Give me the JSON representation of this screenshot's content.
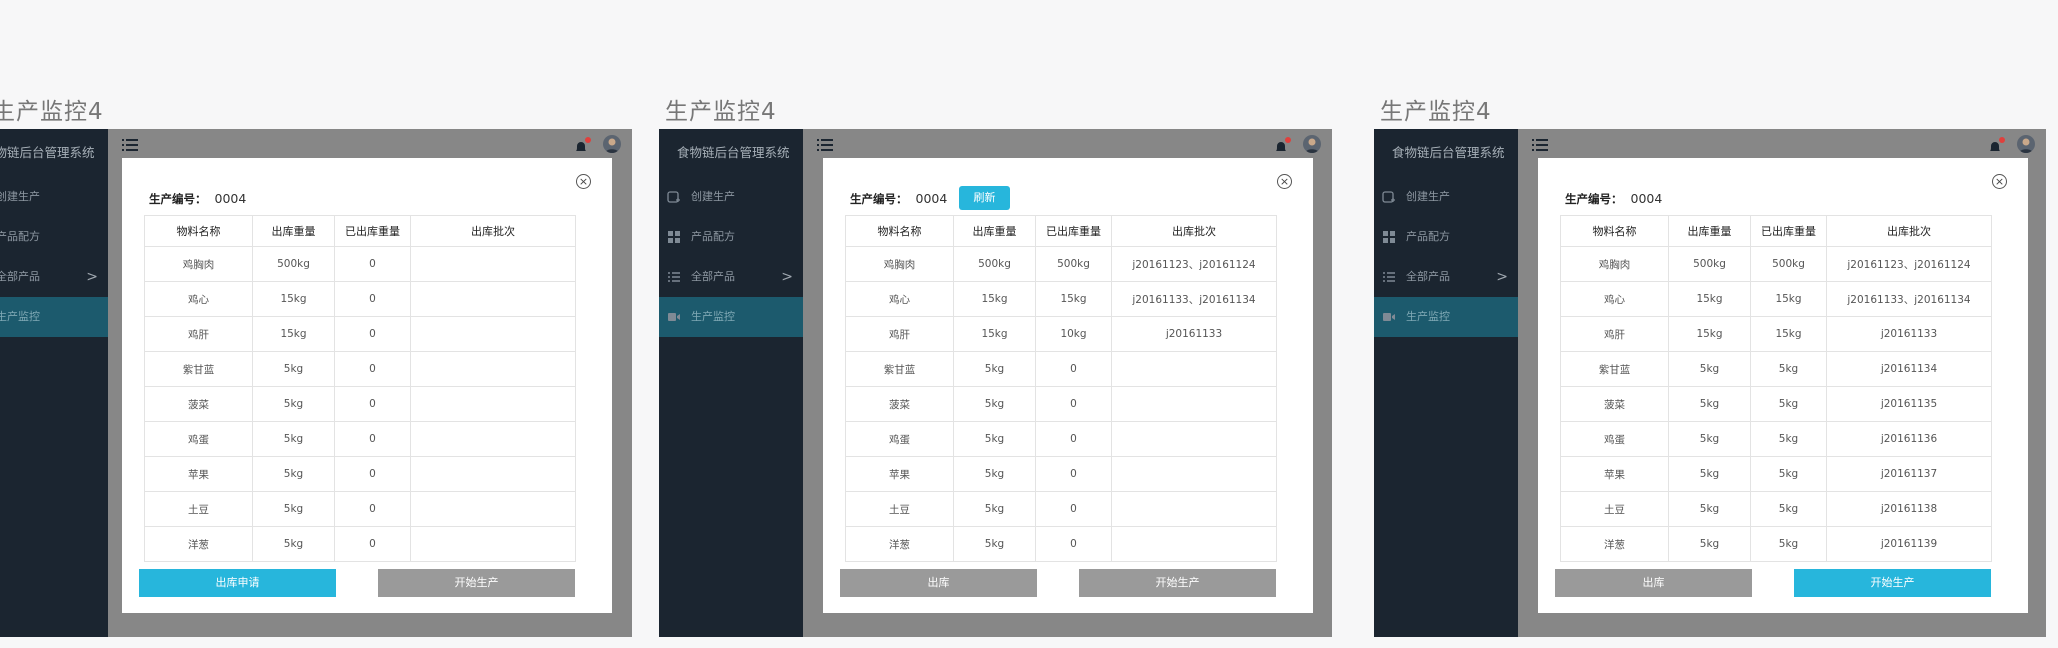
{
  "artboards": [
    {
      "title": "生产监控4",
      "brand": "食物链后台管理系统",
      "nav": [
        {
          "label": "创建生产",
          "icon": "create-production-icon"
        },
        {
          "label": "产品配方",
          "icon": "grid-icon"
        },
        {
          "label": "全部产品",
          "icon": "list-icon",
          "arrow": ">"
        },
        {
          "label": "生产监控",
          "icon": "video-icon",
          "active": true
        }
      ],
      "modal": {
        "code_label": "生产编号：",
        "code_value": "0004",
        "refresh_label": "",
        "columns": [
          "物料名称",
          "出库重量",
          "已出库重量",
          "出库批次"
        ],
        "rows": [
          [
            "鸡胸肉",
            "500kg",
            "0",
            ""
          ],
          [
            "鸡心",
            "15kg",
            "0",
            ""
          ],
          [
            "鸡肝",
            "15kg",
            "0",
            ""
          ],
          [
            "紫甘蓝",
            "5kg",
            "0",
            ""
          ],
          [
            "菠菜",
            "5kg",
            "0",
            ""
          ],
          [
            "鸡蛋",
            "5kg",
            "0",
            ""
          ],
          [
            "苹果",
            "5kg",
            "0",
            ""
          ],
          [
            "土豆",
            "5kg",
            "0",
            ""
          ],
          [
            "洋葱",
            "5kg",
            "0",
            ""
          ]
        ],
        "left_button": "出库申请",
        "right_button": "开始生产",
        "left_button_style": "blue",
        "right_button_style": "gray"
      }
    },
    {
      "title": "生产监控4",
      "brand": "食物链后台管理系统",
      "nav": [
        {
          "label": "创建生产",
          "icon": "create-production-icon"
        },
        {
          "label": "产品配方",
          "icon": "grid-icon"
        },
        {
          "label": "全部产品",
          "icon": "list-icon",
          "arrow": ">"
        },
        {
          "label": "生产监控",
          "icon": "video-icon",
          "active": true
        }
      ],
      "modal": {
        "code_label": "生产编号：",
        "code_value": "0004",
        "refresh_label": "刷新",
        "columns": [
          "物料名称",
          "出库重量",
          "已出库重量",
          "出库批次"
        ],
        "rows": [
          [
            "鸡胸肉",
            "500kg",
            "500kg",
            "j20161123、j20161124"
          ],
          [
            "鸡心",
            "15kg",
            "15kg",
            "j20161133、j20161134"
          ],
          [
            "鸡肝",
            "15kg",
            "10kg",
            "j20161133"
          ],
          [
            "紫甘蓝",
            "5kg",
            "0",
            ""
          ],
          [
            "菠菜",
            "5kg",
            "0",
            ""
          ],
          [
            "鸡蛋",
            "5kg",
            "0",
            ""
          ],
          [
            "苹果",
            "5kg",
            "0",
            ""
          ],
          [
            "土豆",
            "5kg",
            "0",
            ""
          ],
          [
            "洋葱",
            "5kg",
            "0",
            ""
          ]
        ],
        "left_button": "出库",
        "right_button": "开始生产",
        "left_button_style": "gray",
        "right_button_style": "gray"
      }
    },
    {
      "title": "生产监控4",
      "brand": "食物链后台管理系统",
      "nav": [
        {
          "label": "创建生产",
          "icon": "create-production-icon"
        },
        {
          "label": "产品配方",
          "icon": "grid-icon"
        },
        {
          "label": "全部产品",
          "icon": "list-icon",
          "arrow": ">"
        },
        {
          "label": "生产监控",
          "icon": "video-icon",
          "active": true
        }
      ],
      "modal": {
        "code_label": "生产编号：",
        "code_value": "0004",
        "refresh_label": "",
        "columns": [
          "物料名称",
          "出库重量",
          "已出库重量",
          "出库批次"
        ],
        "rows": [
          [
            "鸡胸肉",
            "500kg",
            "500kg",
            "j20161123、j20161124"
          ],
          [
            "鸡心",
            "15kg",
            "15kg",
            "j20161133、j20161134"
          ],
          [
            "鸡肝",
            "15kg",
            "15kg",
            "j20161133"
          ],
          [
            "紫甘蓝",
            "5kg",
            "5kg",
            "j20161134"
          ],
          [
            "菠菜",
            "5kg",
            "5kg",
            "j20161135"
          ],
          [
            "鸡蛋",
            "5kg",
            "5kg",
            "j20161136"
          ],
          [
            "苹果",
            "5kg",
            "5kg",
            "j20161137"
          ],
          [
            "土豆",
            "5kg",
            "5kg",
            "j20161138"
          ],
          [
            "洋葱",
            "5kg",
            "5kg",
            "j20161139"
          ]
        ],
        "left_button": "出库",
        "right_button": "开始生产",
        "left_button_style": "gray",
        "right_button_style": "blue"
      }
    }
  ],
  "colors": {
    "accent": "#27b6dc",
    "sidebar": "#1b2530",
    "active_nav": "#1c5a6d",
    "overlay": "#878787",
    "zero_value": "#e0424f"
  }
}
